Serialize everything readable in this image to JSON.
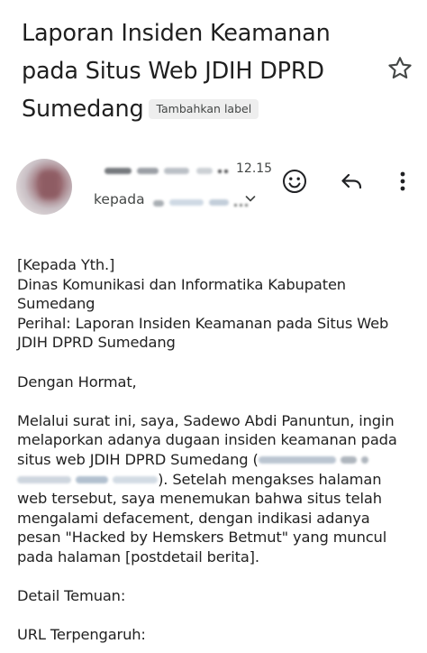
{
  "email": {
    "subject": "Laporan Insiden Keamanan pada Situs Web JDIH DPRD Sumedang",
    "label_chip": "Tambahkan label",
    "time": "12.15",
    "recipient_prefix": "kepada",
    "icons": {
      "star": "star-icon",
      "emoji": "emoji-reaction-icon",
      "reply": "reply-icon",
      "more": "more-vert-icon",
      "expand": "chevron-down-icon"
    }
  },
  "body": {
    "to_header": "[Kepada Yth.]",
    "to_org": "Dinas Komunikasi dan Informatika Kabupaten Sumedang",
    "regarding": "Perihal: Laporan Insiden Keamanan pada Situs Web JDIH DPRD Sumedang",
    "greeting": "Dengan Hormat,",
    "para1_a": "Melalui surat ini, saya, Sadewo Abdi Panuntun, ingin melaporkan adanya dugaan insiden keamanan pada situs web JDIH DPRD Sumedang (",
    "para1_b": "). Setelah mengakses halaman web tersebut, saya menemukan bahwa situs telah mengalami defacement, dengan indikasi adanya pesan \"Hacked by Hemskers Betmut\" yang muncul pada halaman [postdetail berita].",
    "detail_heading": "Detail Temuan:",
    "url_label": "URL Terpengaruh:"
  },
  "colors": {
    "text": "#222222",
    "secondary": "#444746",
    "chip_bg": "#eeeeee"
  }
}
